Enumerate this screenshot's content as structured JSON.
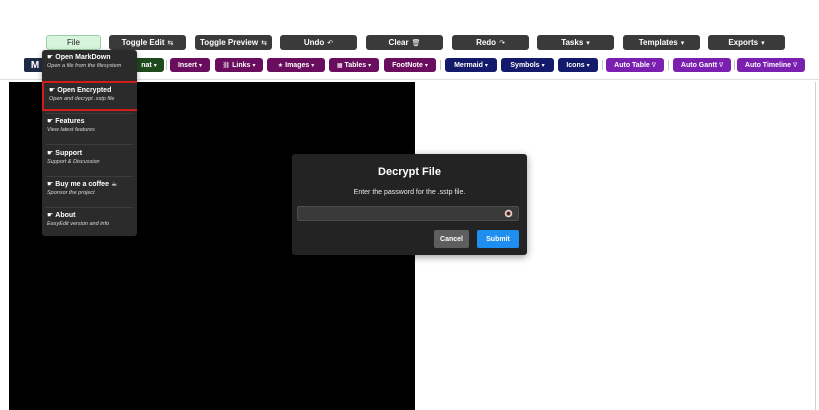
{
  "toolbar1": {
    "file": "File",
    "toggle_edit": "Toggle Edit",
    "toggle_edit_icon": "⇆",
    "toggle_preview": "Toggle Preview",
    "toggle_preview_icon": "⇆",
    "undo": "Undo",
    "undo_icon": "↶",
    "clear": "Clear",
    "clear_icon": "🗑",
    "redo": "Redo",
    "redo_icon": "↷",
    "tasks": "Tasks",
    "templates": "Templates",
    "exports": "Exports",
    "dropdown_icon": "▾"
  },
  "toolbar2": {
    "logo": "M",
    "format": "nat",
    "insert": "Insert",
    "links": "Links",
    "links_icon": "⛓",
    "images": "Images",
    "images_icon": "★",
    "tables": "Tables",
    "tables_icon": "▦",
    "footnote": "FootNote",
    "mermaid": "Mermaid",
    "symbols": "Symbols",
    "icons": "Icons",
    "auto_table": "Auto Table",
    "auto_gantt": "Auto Gantt",
    "auto_timeline": "Auto Timeline",
    "auto_icon": "∇",
    "dropdown_icon": "▾"
  },
  "file_menu": {
    "bullet": "☛",
    "items": [
      {
        "title": "Open MarkDown",
        "desc": "Open a file from the filesystem",
        "icon": ""
      },
      {
        "title": "Open Encrypted",
        "desc": "Open and decrypt .sstp file",
        "icon": ""
      },
      {
        "title": "Features",
        "desc": "View latest features",
        "icon": ""
      },
      {
        "title": "Support",
        "desc": "Support & Discussion",
        "icon": ""
      },
      {
        "title": "Buy me a coffee",
        "desc": "Sponsor the project",
        "icon": "☕"
      },
      {
        "title": "About",
        "desc": "EasyEdit version and info",
        "icon": ""
      }
    ]
  },
  "decrypt_dialog": {
    "title": "Decrypt File",
    "message": "Enter the password for the .sstp file.",
    "password_value": "",
    "password_placeholder": "",
    "cancel_label": "Cancel",
    "submit_label": "Submit"
  },
  "colors": {
    "menu_bg": "#2b2b2b",
    "modal_bg": "#232323",
    "submit_blue": "#1e8ef0",
    "highlight_red": "#d11c1c",
    "purple": "#6a0d5e",
    "navy": "#141a6b",
    "violet": "#7b1fb0"
  },
  "icons": {
    "eye": "eye-icon",
    "bullet": "hand-pointer-icon"
  }
}
